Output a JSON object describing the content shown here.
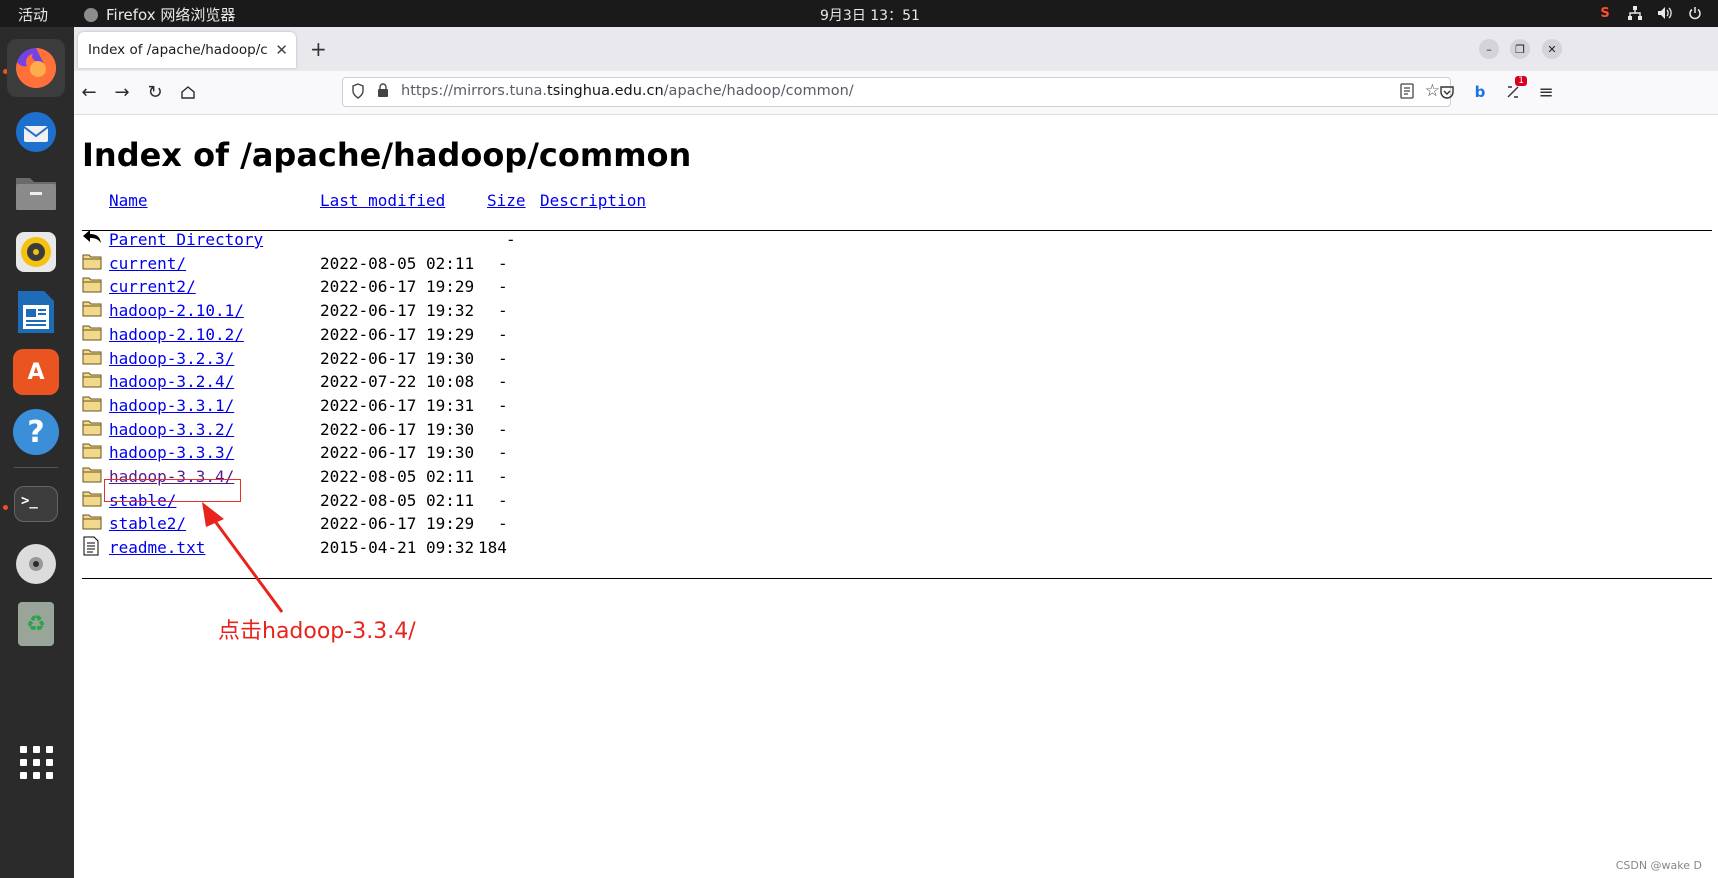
{
  "topbar": {
    "activities": "活动",
    "app_name": "Firefox 网络浏览器",
    "clock": "9月3日  13：51",
    "tray_icons": [
      "csdn-icon",
      "network-icon",
      "volume-icon",
      "power-icon"
    ]
  },
  "dock": {
    "items": [
      {
        "name": "firefox",
        "color": "#ff7139",
        "running": true,
        "active": true
      },
      {
        "name": "thunderbird",
        "color": "#1e70cd",
        "running": false
      },
      {
        "name": "files",
        "color": "#7e7e7e",
        "running": false
      },
      {
        "name": "rhythmbox",
        "color": "#f5c211",
        "running": false
      },
      {
        "name": "libreoffice-writer",
        "color": "#1e6bb8",
        "running": false
      },
      {
        "name": "software",
        "color": "#e95420",
        "running": false
      },
      {
        "name": "help",
        "color": "#3a8fd8",
        "running": false
      },
      {
        "name": "terminal",
        "color": "#3d3d3d",
        "running": true
      },
      {
        "name": "dvd",
        "color": "#d8d8d8",
        "running": false
      },
      {
        "name": "trash",
        "color": "#9aa59a",
        "running": false
      }
    ],
    "terminal_glyph": ">_",
    "help_glyph": "?",
    "software_glyph": "A",
    "trash_glyph": "♻"
  },
  "browser": {
    "tab_title": "Index of /apache/hadoop/common/",
    "tab_close": "✕",
    "new_tab": "+",
    "url_prefix": "https://mirrors.tuna.",
    "url_host": "tsinghua.edu.cn",
    "url_path": "/apache/hadoop/common/",
    "extension_badge": "1"
  },
  "page": {
    "title": "Index of /apache/hadoop/common",
    "columns": {
      "name": "Name",
      "last_modified": "Last modified",
      "size": "Size",
      "description": "Description"
    },
    "rows": [
      {
        "name": "Parent Directory",
        "date": "",
        "size": "-",
        "icon": "back",
        "visited": false
      },
      {
        "name": "current/",
        "date": "2022-08-05 02:11",
        "size": "-",
        "icon": "folder",
        "visited": false
      },
      {
        "name": "current2/",
        "date": "2022-06-17 19:29",
        "size": "-",
        "icon": "folder",
        "visited": false
      },
      {
        "name": "hadoop-2.10.1/",
        "date": "2022-06-17 19:32",
        "size": "-",
        "icon": "folder",
        "visited": false
      },
      {
        "name": "hadoop-2.10.2/",
        "date": "2022-06-17 19:29",
        "size": "-",
        "icon": "folder",
        "visited": false
      },
      {
        "name": "hadoop-3.2.3/",
        "date": "2022-06-17 19:30",
        "size": "-",
        "icon": "folder",
        "visited": false
      },
      {
        "name": "hadoop-3.2.4/",
        "date": "2022-07-22 10:08",
        "size": "-",
        "icon": "folder",
        "visited": false
      },
      {
        "name": "hadoop-3.3.1/",
        "date": "2022-06-17 19:31",
        "size": "-",
        "icon": "folder",
        "visited": false
      },
      {
        "name": "hadoop-3.3.2/",
        "date": "2022-06-17 19:30",
        "size": "-",
        "icon": "folder",
        "visited": false
      },
      {
        "name": "hadoop-3.3.3/",
        "date": "2022-06-17 19:30",
        "size": "-",
        "icon": "folder",
        "visited": false
      },
      {
        "name": "hadoop-3.3.4/",
        "date": "2022-08-05 02:11",
        "size": "-",
        "icon": "folder",
        "visited": true
      },
      {
        "name": "stable/",
        "date": "2022-08-05 02:11",
        "size": "-",
        "icon": "folder",
        "visited": false
      },
      {
        "name": "stable2/",
        "date": "2022-06-17 19:29",
        "size": "-",
        "icon": "folder",
        "visited": false
      },
      {
        "name": "readme.txt",
        "date": "2015-04-21 09:32",
        "size": "184",
        "icon": "text",
        "visited": false
      }
    ]
  },
  "annotation": {
    "text": "点击hadoop-3.3.4/",
    "color": "#e8231c"
  },
  "watermark": "CSDN @wake D"
}
